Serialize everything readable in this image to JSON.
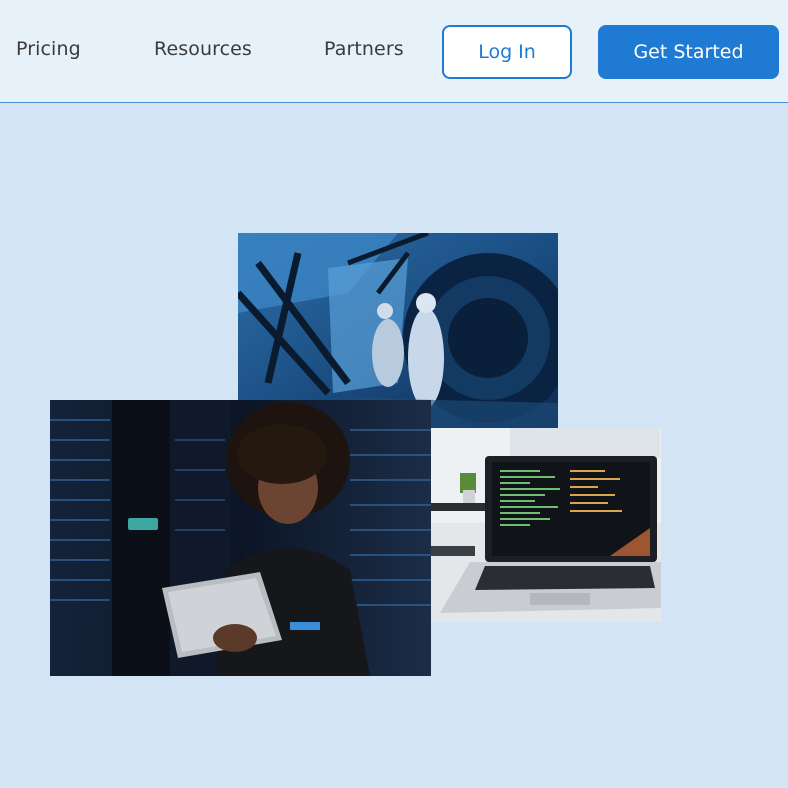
{
  "nav": {
    "links": [
      "Pricing",
      "Resources",
      "Partners"
    ],
    "login_label": "Log In",
    "cta_label": "Get Started"
  },
  "colors": {
    "accent": "#1f7ad4",
    "page_bg": "#d3e5f5",
    "header_bg": "#e6f1fa"
  },
  "images": [
    {
      "name": "cleanroom-technicians-photo",
      "icon": "photo-icon"
    },
    {
      "name": "woman-with-tablet-server-room-photo",
      "icon": "photo-icon"
    },
    {
      "name": "laptop-with-code-photo",
      "icon": "photo-icon"
    }
  ]
}
